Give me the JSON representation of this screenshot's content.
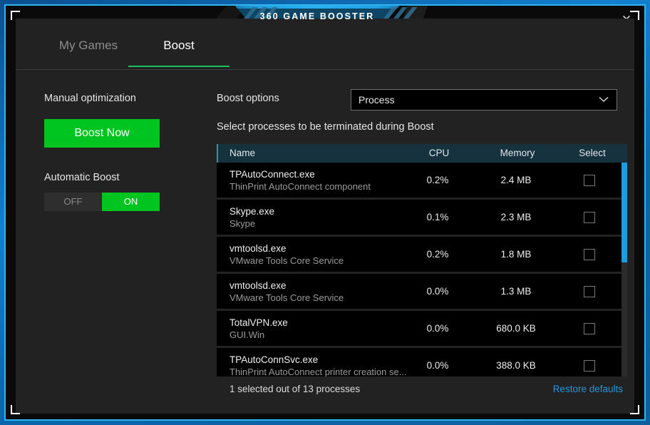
{
  "window": {
    "title": "360 GAME BOOSTER",
    "minimize_label": "—",
    "close_label": "✕"
  },
  "tabs": [
    {
      "id": "my-games",
      "label": "My Games",
      "active": false
    },
    {
      "id": "boost",
      "label": "Boost",
      "active": true
    }
  ],
  "left_panel": {
    "manual_label": "Manual optimization",
    "boost_now_label": "Boost Now",
    "automatic_label": "Automatic Boost",
    "toggle": {
      "off_label": "OFF",
      "on_label": "ON",
      "state": "ON"
    }
  },
  "right_panel": {
    "boost_options_label": "Boost options",
    "dropdown": {
      "value": "Process",
      "icon": "chevron-down-icon"
    },
    "instruction": "Select processes to be terminated during Boost"
  },
  "table": {
    "columns": [
      "Name",
      "CPU",
      "Memory",
      "Select"
    ],
    "rows": [
      {
        "name": "TPAutoConnect.exe",
        "desc": "ThinPrint AutoConnect component",
        "cpu": "0.2%",
        "memory": "2.4 MB",
        "checked": false
      },
      {
        "name": "Skype.exe",
        "desc": "Skype",
        "cpu": "0.1%",
        "memory": "2.3 MB",
        "checked": false
      },
      {
        "name": "vmtoolsd.exe",
        "desc": "VMware Tools Core Service",
        "cpu": "0.2%",
        "memory": "1.8 MB",
        "checked": false
      },
      {
        "name": "vmtoolsd.exe",
        "desc": "VMware Tools Core Service",
        "cpu": "0.0%",
        "memory": "1.3 MB",
        "checked": false
      },
      {
        "name": "TotalVPN.exe",
        "desc": "GUI.Win",
        "cpu": "0.0%",
        "memory": "680.0 KB",
        "checked": false
      },
      {
        "name": "TPAutoConnSvc.exe",
        "desc": "ThinPrint AutoConnect printer creation se...",
        "cpu": "0.0%",
        "memory": "388.0 KB",
        "checked": false
      }
    ],
    "footer_count": "1 selected out of 13 processes",
    "restore_defaults_label": "Restore defaults"
  },
  "colors": {
    "accent_green": "#00c520",
    "accent_blue": "#1b9de0",
    "link_blue": "#2b93d6",
    "tab_underline": "#19c25a",
    "frame_blue": "#2fb6f0",
    "header_bg": "#16323f"
  }
}
